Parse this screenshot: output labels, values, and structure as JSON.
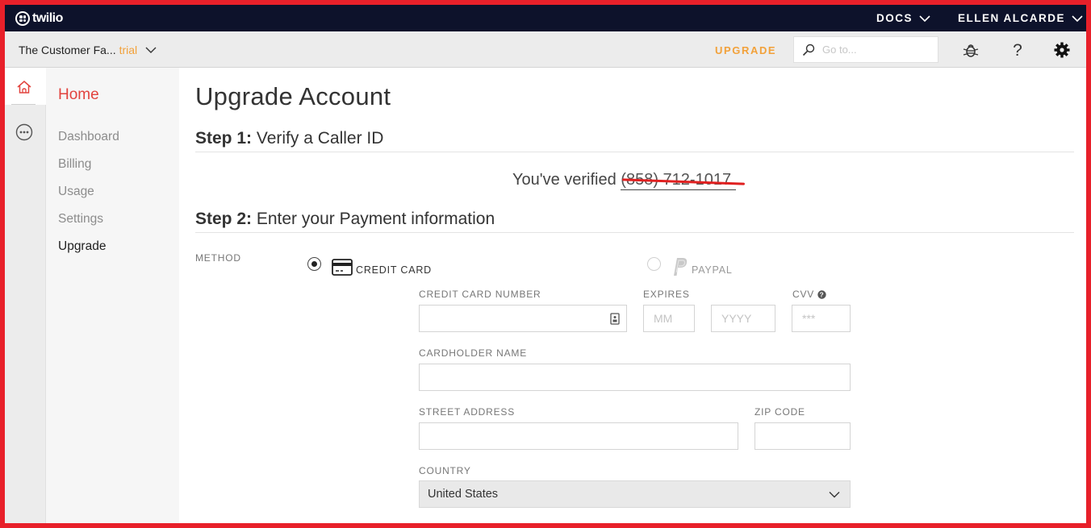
{
  "topbar": {
    "logo_text": "twilio",
    "docs_label": "DOCS",
    "user_label": "ELLEN ALCARDE"
  },
  "subbar": {
    "account_name": "The Customer Fa...",
    "account_tag": "trial",
    "upgrade_label": "UPGRADE",
    "search_placeholder": "Go to..."
  },
  "sidenav": {
    "section": "Home",
    "items": [
      {
        "label": "Dashboard",
        "active": false
      },
      {
        "label": "Billing",
        "active": false
      },
      {
        "label": "Usage",
        "active": false
      },
      {
        "label": "Settings",
        "active": false
      },
      {
        "label": "Upgrade",
        "active": true
      }
    ]
  },
  "page": {
    "title": "Upgrade Account",
    "step1": {
      "prefix": "Step 1:",
      "text": "Verify a Caller ID"
    },
    "verified_text": "You've verified",
    "verified_number": "(858) 712-1017.",
    "step2": {
      "prefix": "Step 2:",
      "text": "Enter your Payment information"
    }
  },
  "payment": {
    "method_label": "METHOD",
    "credit_card_label": "CREDIT CARD",
    "paypal_label": "PAYPAL",
    "selected_method": "credit_card",
    "card_number_label": "CREDIT CARD NUMBER",
    "expires_label": "EXPIRES",
    "month_placeholder": "MM",
    "year_placeholder": "YYYY",
    "cvv_label": "CVV",
    "cvv_placeholder": "***",
    "cardholder_label": "CARDHOLDER NAME",
    "street_label": "STREET ADDRESS",
    "zip_label": "ZIP CODE",
    "country_label": "COUNTRY",
    "country_value": "United States"
  },
  "colors": {
    "topbar_bg": "#0d122b",
    "accent_red": "#e2433e",
    "upgrade_orange": "#f2a13a"
  }
}
